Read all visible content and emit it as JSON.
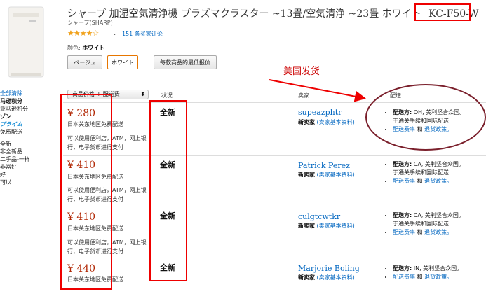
{
  "product": {
    "title_main": "シャープ 加湿空気清浄機 プラズマクラスター ~13畳/空気清浄 ~23畳 ホワイト",
    "model": "KC-F50-W",
    "brand": "シャープ(SHARP)",
    "stars": "★★★★☆",
    "reviews": "151 条买家评论",
    "color_label": "颜色:",
    "color_value": "ホワイト",
    "buttons": [
      "ベージュ",
      "ホワイト",
      "每款商品的最低报价"
    ]
  },
  "annotation": "美国发货",
  "sidebar": [
    "全部清除",
    "马逊积分",
    "亚马逊积分",
    "ゾン",
    "プライム",
    "免费配送",
    "全新",
    "非全新品",
    "二手品-一样",
    "非常好",
    "好",
    "可以"
  ],
  "headers": {
    "sort": "商品价格 + 配送费",
    "condition": "状况",
    "seller": "卖家",
    "shipping": "配送"
  },
  "offers": [
    {
      "price": "¥ 280",
      "free": "日本关东地区免费配送",
      "pay": "可以使用便利店，ATM，网上银行，电子货币进行支付",
      "condition": "全新",
      "seller": "supeazphtr",
      "seller_tag": "新卖家",
      "seller_link": "(卖家基本资料)",
      "ship_label": "配送方:",
      "ship_to": "OH, 美利坚合众国。",
      "ship_cont": "于通关手续和国际配送",
      "ship_fee": "配送费率",
      "ship_and": "和",
      "ship_policy": "退货政策。"
    },
    {
      "price": "¥ 410",
      "free": "日本关东地区免费配送",
      "pay": "可以使用便利店，ATM，网上银行，电子货币进行支付",
      "condition": "全新",
      "seller": "Patrick Perez",
      "seller_tag": "新卖家",
      "seller_link": "(卖家基本资料)",
      "ship_label": "配送方:",
      "ship_to": "CA, 美利坚合众国。",
      "ship_cont": "于通关手续和国际配送",
      "ship_fee": "配送费率",
      "ship_and": "和",
      "ship_policy": "退货政策。"
    },
    {
      "price": "¥ 410",
      "free": "日本关东地区免费配送",
      "pay": "可以使用便利店，ATM，网上银行，电子货币进行支付",
      "condition": "全新",
      "seller": "culgtcwtkr",
      "seller_tag": "新卖家",
      "seller_link": "(卖家基本资料)",
      "ship_label": "配送方:",
      "ship_to": "CA, 美利坚合众国。",
      "ship_cont": "于通关手续和国际配送",
      "ship_fee": "配送费率",
      "ship_and": "和",
      "ship_policy": "退货政策。"
    },
    {
      "price": "¥ 440",
      "free": "日本关东地区免费配送",
      "pay": "",
      "condition": "全新",
      "seller": "Marjorie Boling",
      "seller_tag": "新卖家",
      "seller_link": "(卖家基本资料)",
      "ship_label": "配送方:",
      "ship_to": "IN, 美利坚合众国。",
      "ship_cont": "",
      "ship_fee": "配送费率",
      "ship_and": "和",
      "ship_policy": "退货政策。"
    }
  ],
  "colors": {
    "price": "#b12704",
    "link": "#0066c0",
    "annotation_box": "#ee0000",
    "ellipse": "#7a1f2b"
  }
}
